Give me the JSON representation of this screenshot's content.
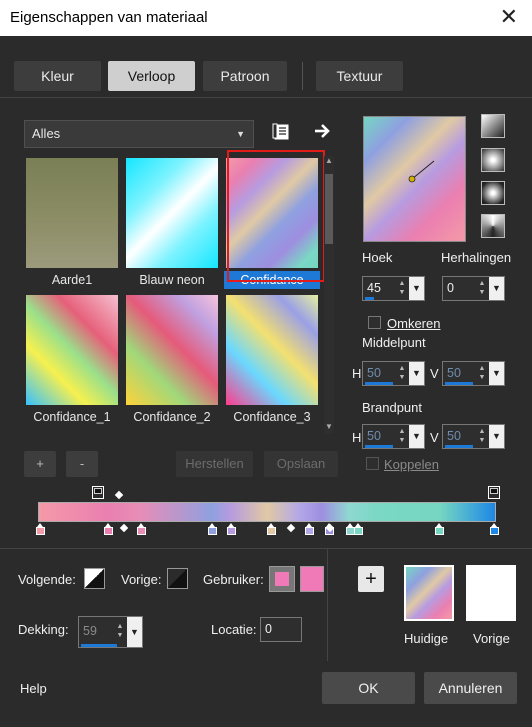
{
  "window": {
    "title": "Eigenschappen van materiaal",
    "close_glyph": "✕"
  },
  "tabs": [
    {
      "label": "Kleur",
      "active": false
    },
    {
      "label": "Verloop",
      "active": true
    },
    {
      "label": "Patroon",
      "active": false
    },
    {
      "label": "Textuur",
      "active": false
    }
  ],
  "category": {
    "selected": "Alles"
  },
  "thumbnails": [
    {
      "label": "Aarde1",
      "selected": false
    },
    {
      "label": "Blauw neon",
      "selected": false
    },
    {
      "label": "Confidance",
      "selected": true
    },
    {
      "label": "Confidance_1",
      "selected": false
    },
    {
      "label": "Confidance_2",
      "selected": false
    },
    {
      "label": "Confidance_3",
      "selected": false
    }
  ],
  "gallery_buttons": {
    "add": "+",
    "remove": "-",
    "reset": "Herstellen",
    "save": "Opslaan"
  },
  "hoek": {
    "label": "Hoek",
    "value": "45"
  },
  "herhalingen": {
    "label": "Herhalingen",
    "value": "0"
  },
  "omkeren": {
    "label": "Omkeren",
    "checked": false
  },
  "middelpunt": {
    "label": "Middelpunt",
    "h_label": "H",
    "h_value": "50",
    "v_label": "V",
    "v_value": "50"
  },
  "brandpunt": {
    "label": "Brandpunt",
    "h_label": "H",
    "h_value": "50",
    "v_label": "V",
    "v_value": "50"
  },
  "koppelen": {
    "label": "Koppelen",
    "checked": false
  },
  "gradient_stops": {
    "colors": [
      "#f59aa8",
      "#ea7fb0",
      "#e88db6",
      "#8fa0e0",
      "#b69be0",
      "#e0c9a4",
      "#b4a8e8",
      "#9e8ee0",
      "#8fd8d0",
      "#7ad8c4",
      "#75d6c2",
      "#1e88e6"
    ]
  },
  "bottom": {
    "volgende_label": "Volgende:",
    "vorige_label": "Vorige:",
    "gebruiker_label": "Gebruiker:",
    "dekking_label": "Dekking:",
    "dekking_value": "59",
    "locatie_label": "Locatie:",
    "locatie_value": "0",
    "user_color": "#f07ab8",
    "huidige_label": "Huidige",
    "vorige_swatch_label": "Vorige",
    "add_glyph": "+"
  },
  "footer": {
    "help": "Help",
    "ok": "OK",
    "cancel": "Annuleren"
  },
  "colors": {
    "accent": "#1e78d6",
    "selection_outline": "#e21b1b",
    "background": "#2b2b2b"
  }
}
